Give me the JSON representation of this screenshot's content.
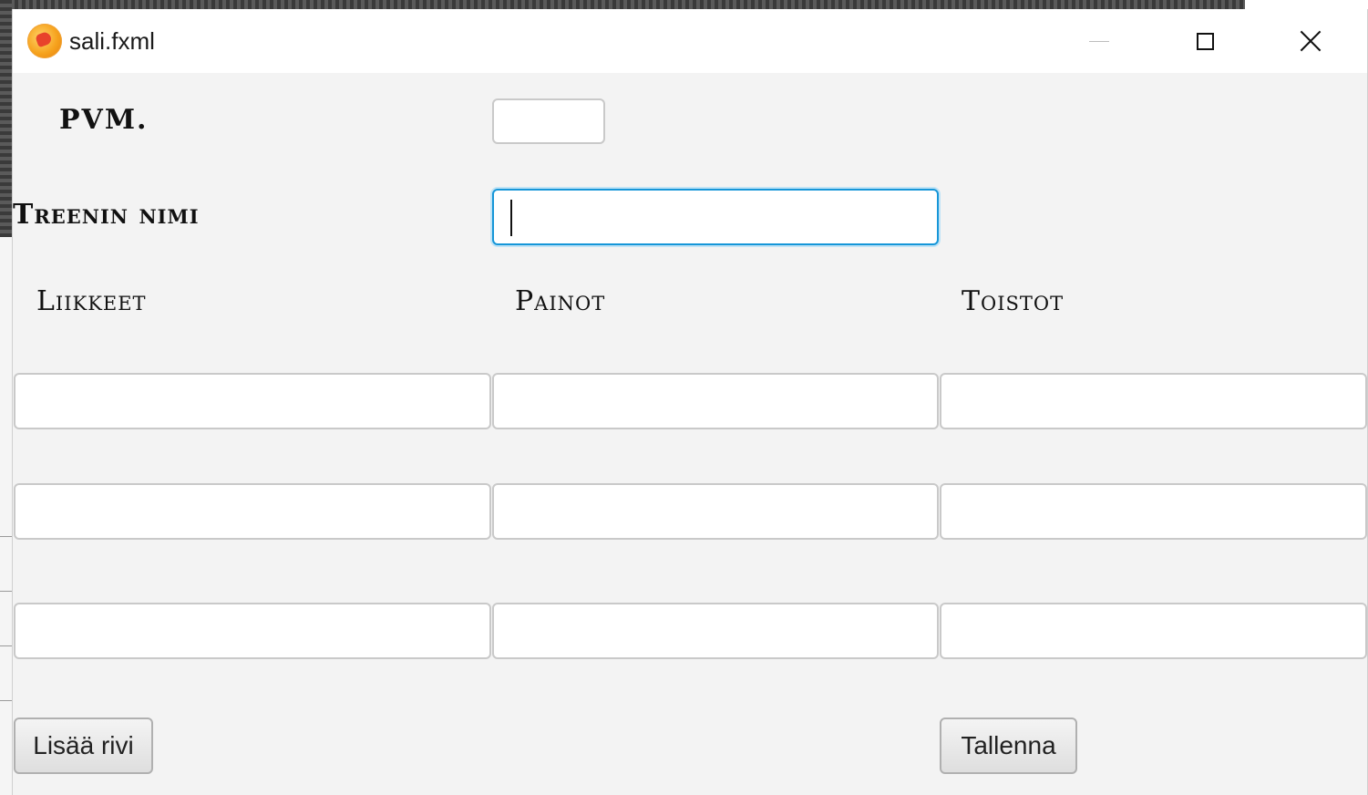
{
  "window": {
    "title": "sali.fxml",
    "icon": "app-hand-icon",
    "controls": {
      "minimize": "minimize-icon",
      "maximize": "maximize-icon",
      "close": "close-icon"
    }
  },
  "form": {
    "date_label": "PVM.",
    "date_value": "",
    "name_label": "Treenin nimi",
    "name_value": "",
    "columns": [
      "Liikkeet",
      "Painot",
      "Toistot"
    ],
    "rows": [
      [
        "",
        "",
        ""
      ],
      [
        "",
        "",
        ""
      ],
      [
        "",
        "",
        ""
      ]
    ],
    "add_row_label": "Lisää rivi",
    "save_label": "Tallenna"
  },
  "colors": {
    "window_bg": "#f3f3f3",
    "focus_border": "#1696d8",
    "field_border": "#c9c9c9"
  }
}
